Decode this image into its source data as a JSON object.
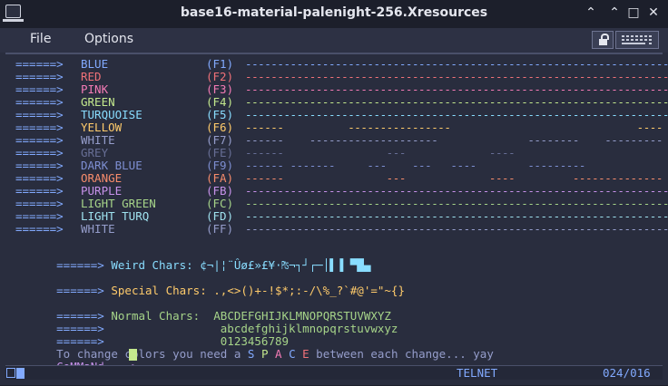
{
  "window": {
    "title": "base16-material-palenight-256.Xresources"
  },
  "menubar": {
    "file": "File",
    "options": "Options"
  },
  "colors": {
    "blue": "#82aaff",
    "red": "#f07178",
    "pink": "#f47bb6",
    "green": "#c3e88d",
    "turquoise": "#89ddff",
    "yellow": "#ffcb6b",
    "white": "#959dcb",
    "grey": "#676e95",
    "darkblue": "#7d8ed1",
    "orange": "#f78c6c",
    "purple": "#c792ea",
    "lightgreen": "#a6d489",
    "lightturq": "#9fe2ef",
    "white2": "#bfc7d5",
    "arrow": "#82aaff",
    "bg": "#292d3e"
  },
  "colorlist": [
    {
      "arrow": "======>",
      "name": "BLUE",
      "key": "(F1)",
      "color": "#82aaff",
      "dashes": "------------------------------------------------------------------"
    },
    {
      "arrow": "======>",
      "name": "RED",
      "key": "(F2)",
      "color": "#f07178",
      "dashes": "------------------------------------------------------------------"
    },
    {
      "arrow": "======>",
      "name": "PINK",
      "key": "(F3)",
      "color": "#f47bb6",
      "dashes": "------------------------------------------------------------------"
    },
    {
      "arrow": "======>",
      "name": "GREEN",
      "key": "(F4)",
      "color": "#c3e88d",
      "dashes": "------------------------------------------------------------------"
    },
    {
      "arrow": "======>",
      "name": "TURQUOISE",
      "key": "(F5)",
      "color": "#89ddff",
      "dashes": "------------------------------------------------------------------"
    },
    {
      "arrow": "======>",
      "name": "YELLOW",
      "key": "(F6)",
      "color": "#ffcb6b",
      "dashes": "------          ----------------                             ----"
    },
    {
      "arrow": "======>",
      "name": "WHITE",
      "key": "(F7)",
      "color": "#959dcb",
      "dashes": "------    --------------------              --------    ---------"
    },
    {
      "arrow": "======>",
      "name": "GREY",
      "key": "(FE)",
      "color": "#676e95",
      "dashes": "------                ---             ----                       "
    },
    {
      "arrow": "======>",
      "name": "DARK BLUE",
      "key": "(F9)",
      "color": "#7d8ed1",
      "dashes": "------ -------     ---    ---   ----        ---------             "
    },
    {
      "arrow": "======>",
      "name": "ORANGE",
      "key": "(FA)",
      "color": "#f78c6c",
      "dashes": "------                ---             ----         --------------"
    },
    {
      "arrow": "======>",
      "name": "PURPLE",
      "key": "(FB)",
      "color": "#c792ea",
      "dashes": "------------------------------------------------------------------"
    },
    {
      "arrow": "======>",
      "name": "LIGHT GREEN",
      "key": "(FC)",
      "color": "#a6d489",
      "dashes": "------------------------------------------------------------------"
    },
    {
      "arrow": "======>",
      "name": "LIGHT TURQ",
      "key": "(FD)",
      "color": "#9fe2ef",
      "dashes": "------------------------------------------------------------------"
    },
    {
      "arrow": "======>",
      "name": "WHITE",
      "key": "(FF)",
      "color": "#959dcb",
      "dashes": "------------------------------------------------------------------"
    }
  ],
  "weird": {
    "arrow": "======>",
    "label": "Weird Chars:",
    "chars": "¢¬|¦¨Ûø£»£¥·₧¬┐┘┌─│▌▐ ▀█▄"
  },
  "special": {
    "arrow": "======>",
    "label": "Special Chars:",
    "chars": ".,<>()+-!$*;:-/\\%_?`#@'=\"~{}"
  },
  "normal": {
    "arrow": "======>",
    "label": "Normal Chars:",
    "upper": "ABCDEFGHIJKLMNOPQRSTUVWXYZ",
    "lower": "abcdefghijklmnopqrstuvwxyz",
    "digits": "0123456789"
  },
  "footer": {
    "pre": "To change colors you need a ",
    "space": [
      "S",
      "P",
      "A",
      "C",
      "E"
    ],
    "post": " between each change... yay",
    "prompt": "CoMMaNd ===>"
  },
  "statusbar": {
    "mode": "TELNET",
    "position": "024/016"
  }
}
